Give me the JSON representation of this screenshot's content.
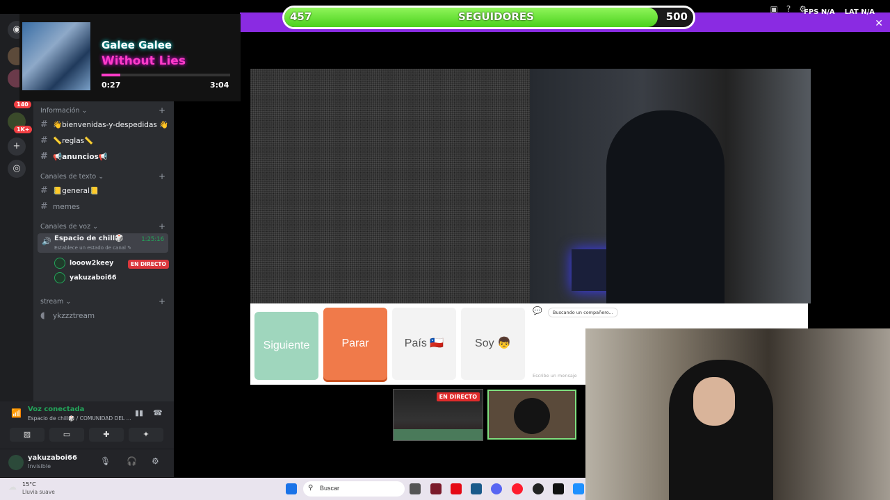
{
  "follow_goal": {
    "current": "457",
    "label": "SEGUIDORES",
    "target": "500",
    "progress": 0.914
  },
  "top_stats": {
    "fps_label": "FPS",
    "fps_value": "N/A",
    "lat_label": "LAT",
    "lat_value": "N/A"
  },
  "music": {
    "artist": "Galee Galee",
    "song": "Without Lies",
    "elapsed": "0:27",
    "duration": "3:04",
    "progress": 0.147
  },
  "rail": {
    "badge_1": "140",
    "badge_2": "1K+"
  },
  "channels": {
    "info_category": "Información",
    "text_category": "Canales de texto",
    "voice_category": "Canales de voz",
    "stream_category": "stream",
    "info_items": [
      "👋bienvenidas-y-despedidas 👋",
      "📏reglas📏",
      "📢anuncios📢"
    ],
    "text_items": [
      "📒general📒",
      "memes"
    ],
    "voice_channel": {
      "name": "Espacio de chill🎲",
      "status": "Establece un estado de canal ✎",
      "time": "1:25:16"
    },
    "voice_users": [
      "looow2keey",
      "yakuzaboi66"
    ],
    "live_label": "EN DIRECTO",
    "stream_item": "ykzzztream"
  },
  "voice_panel": {
    "title": "Voz conectada",
    "subtitle": "Espacio de chill🎲 / COMUNIDAD DEL ..."
  },
  "user_panel": {
    "name": "yakuzaboi66",
    "status": "Invisible"
  },
  "videochat": {
    "buttons": [
      "Siguiente",
      "Parar",
      "País 🇨🇱",
      "Soy 👦"
    ],
    "chat_message": "Buscando un compañero...",
    "chat_placeholder": "Escribe un mensaje"
  },
  "thumb_live": "EN DIRECTO",
  "taskbar": {
    "temp": "15°C",
    "weather": "Lluvia suave",
    "search": "Buscar"
  },
  "colors": {
    "accent_purple": "#8a2be2",
    "goal_green": "#4bd11e",
    "discord_green": "#23a55a",
    "next_btn": "#9fd6bd",
    "stop_btn": "#f07a4a"
  }
}
